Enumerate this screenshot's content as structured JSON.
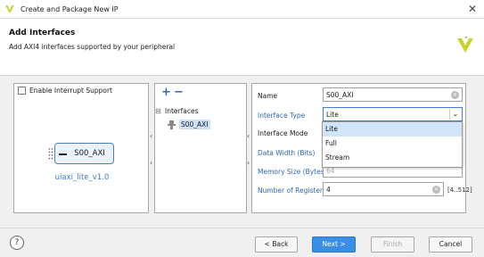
{
  "window": {
    "title": "Create and Package New IP"
  },
  "header": {
    "title": "Add Interfaces",
    "subtitle": "Add AXI4 interfaces supported by your peripheral"
  },
  "left_panel": {
    "interrupt_label": "Enable Interrupt Support",
    "ip_block_label": "S00_AXI",
    "ip_caption": "uiaxi_lite_v1.0"
  },
  "middle_panel": {
    "tree_root": "Interfaces",
    "tree_items": [
      "S00_AXI"
    ]
  },
  "right_panel": {
    "name_label": "Name",
    "name_value": "S00_AXI",
    "type_label": "Interface Type",
    "type_value": "Lite",
    "mode_label": "Interface Mode",
    "width_label": "Data Width (Bits)",
    "mem_label": "Memory Size (Bytes)",
    "mem_value": "64",
    "regs_label": "Number of Registers",
    "regs_value": "4",
    "regs_range": "[4..512]"
  },
  "dropdown": {
    "options": [
      "Lite",
      "Full",
      "Stream"
    ],
    "selected": "Lite"
  },
  "footer": {
    "back": "< Back",
    "next": "Next >",
    "finish": "Finish",
    "cancel": "Cancel",
    "help": "?"
  },
  "colors": {
    "accent": "#3a8ee6",
    "link_blue": "#2c69b0",
    "logo": "#c8d42a"
  }
}
